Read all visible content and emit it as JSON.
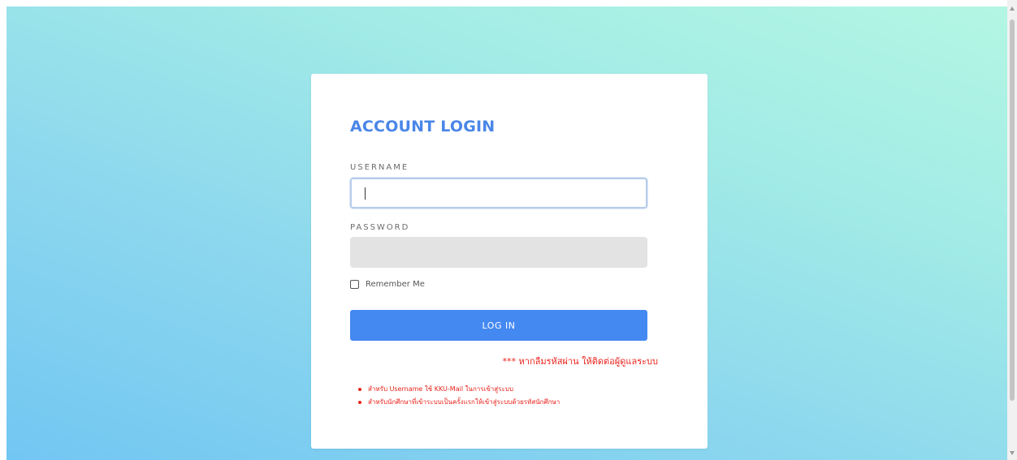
{
  "login": {
    "title": "ACCOUNT LOGIN",
    "username_label": "USERNAME",
    "username_value": "",
    "password_label": "PASSWORD",
    "password_value": "",
    "remember_label": "Remember Me",
    "remember_checked": false,
    "login_button": "LOG IN",
    "forgot_note": "*** หากลืมรหัสผ่าน ให้ติดต่อผู้ดูแลระบบ",
    "notes": [
      "สำหรับ Username ใช้ KKU-Mail ในการเข้าสู่ระบบ",
      "สำหรับนักศึกษาที่เข้าระบบเป็นครั้งแรกให้เข้าสู่ระบบด้วยรหัสนักศึกษา"
    ]
  },
  "colors": {
    "accent": "#4a86e8",
    "button": "#4489f1",
    "warning": "#e8221b",
    "background_start": "#b3f6e3",
    "background_end": "#72c6f2"
  }
}
